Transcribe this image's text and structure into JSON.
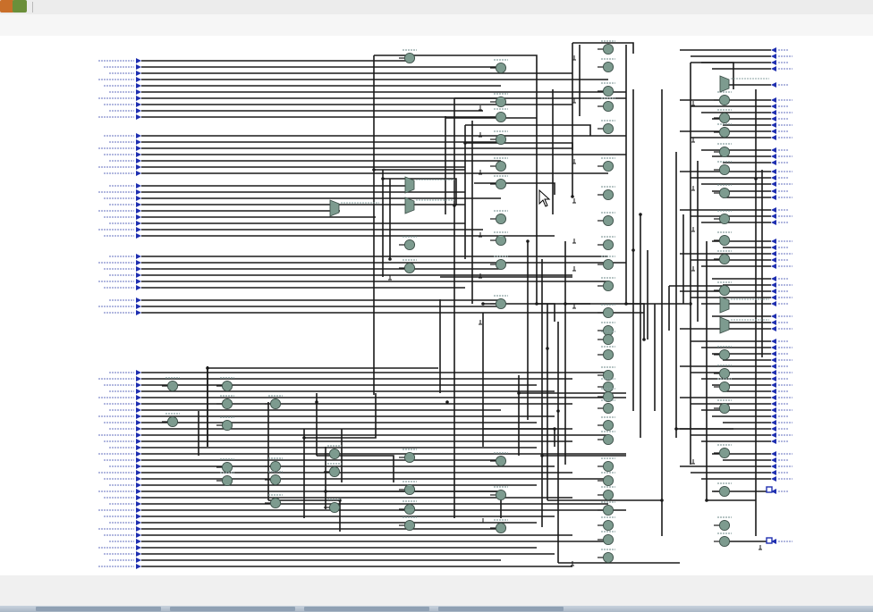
{
  "toolbar": {
    "buttons": [
      {
        "icon": "schematic-tool-icon"
      },
      {
        "icon": "run-tool-icon"
      }
    ]
  },
  "schematic": {
    "wire_color": "#1a1a1a",
    "gate_fill": "#7d9b8f",
    "mux_fill": "#7d9b8f",
    "port_color": "#1f2fb0",
    "label_color": "#3344aa"
  }
}
